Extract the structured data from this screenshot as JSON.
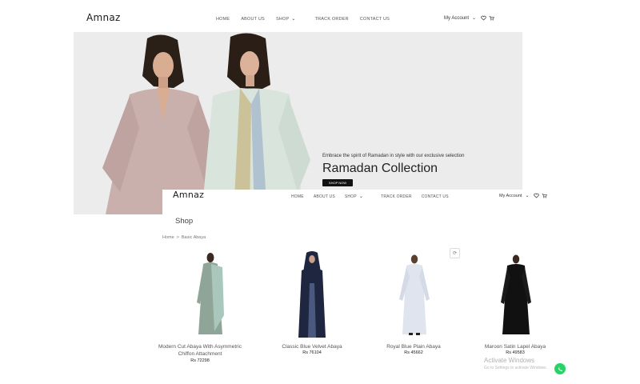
{
  "header": {
    "logo": "Amnaz",
    "nav": [
      "HOME",
      "ABOUT US",
      "SHOP",
      "TRACK ORDER",
      "CONTACT US"
    ],
    "account": "My Account"
  },
  "hero": {
    "subtitle": "Embrace the spirit of Ramadan in style with our exclusive selection",
    "title": "Ramadan Collection",
    "button": "SHOP NOW"
  },
  "overlay_header": {
    "logo": "Amnaz",
    "nav": [
      "HOME",
      "ABOUT US",
      "SHOP",
      "TRACK ORDER",
      "CONTACT US"
    ],
    "account": "My Account"
  },
  "shop": {
    "title": "Shop",
    "breadcrumb": [
      "Home",
      "Basic Abaya"
    ],
    "breadcrumb_sep": ">",
    "products": [
      {
        "name_line1": "Modern Cut Abaya With Asymmetric",
        "name_line2": "Chiffon Attachment",
        "price": "Rs 72298",
        "color": "#8fa597"
      },
      {
        "name_line1": "Classic Blue Velvet Abaya",
        "name_line2": "",
        "price": "Rs 76104",
        "color": "#1f2740"
      },
      {
        "name_line1": "Royal Blue Plain Abaya",
        "name_line2": "",
        "price": "Rs 45662",
        "color": "#dfe4ee"
      },
      {
        "name_line1": "Maroon Satin Lapel Abaya",
        "name_line2": "",
        "price": "Rs 49583",
        "color": "#111111"
      }
    ]
  },
  "watermark": {
    "line1": "Activate Windows",
    "line2": "Go to Settings to activate Windows."
  },
  "colors": {
    "whatsapp": "#25d366",
    "button_bg": "#111111",
    "hero_bg": "#ececec"
  }
}
